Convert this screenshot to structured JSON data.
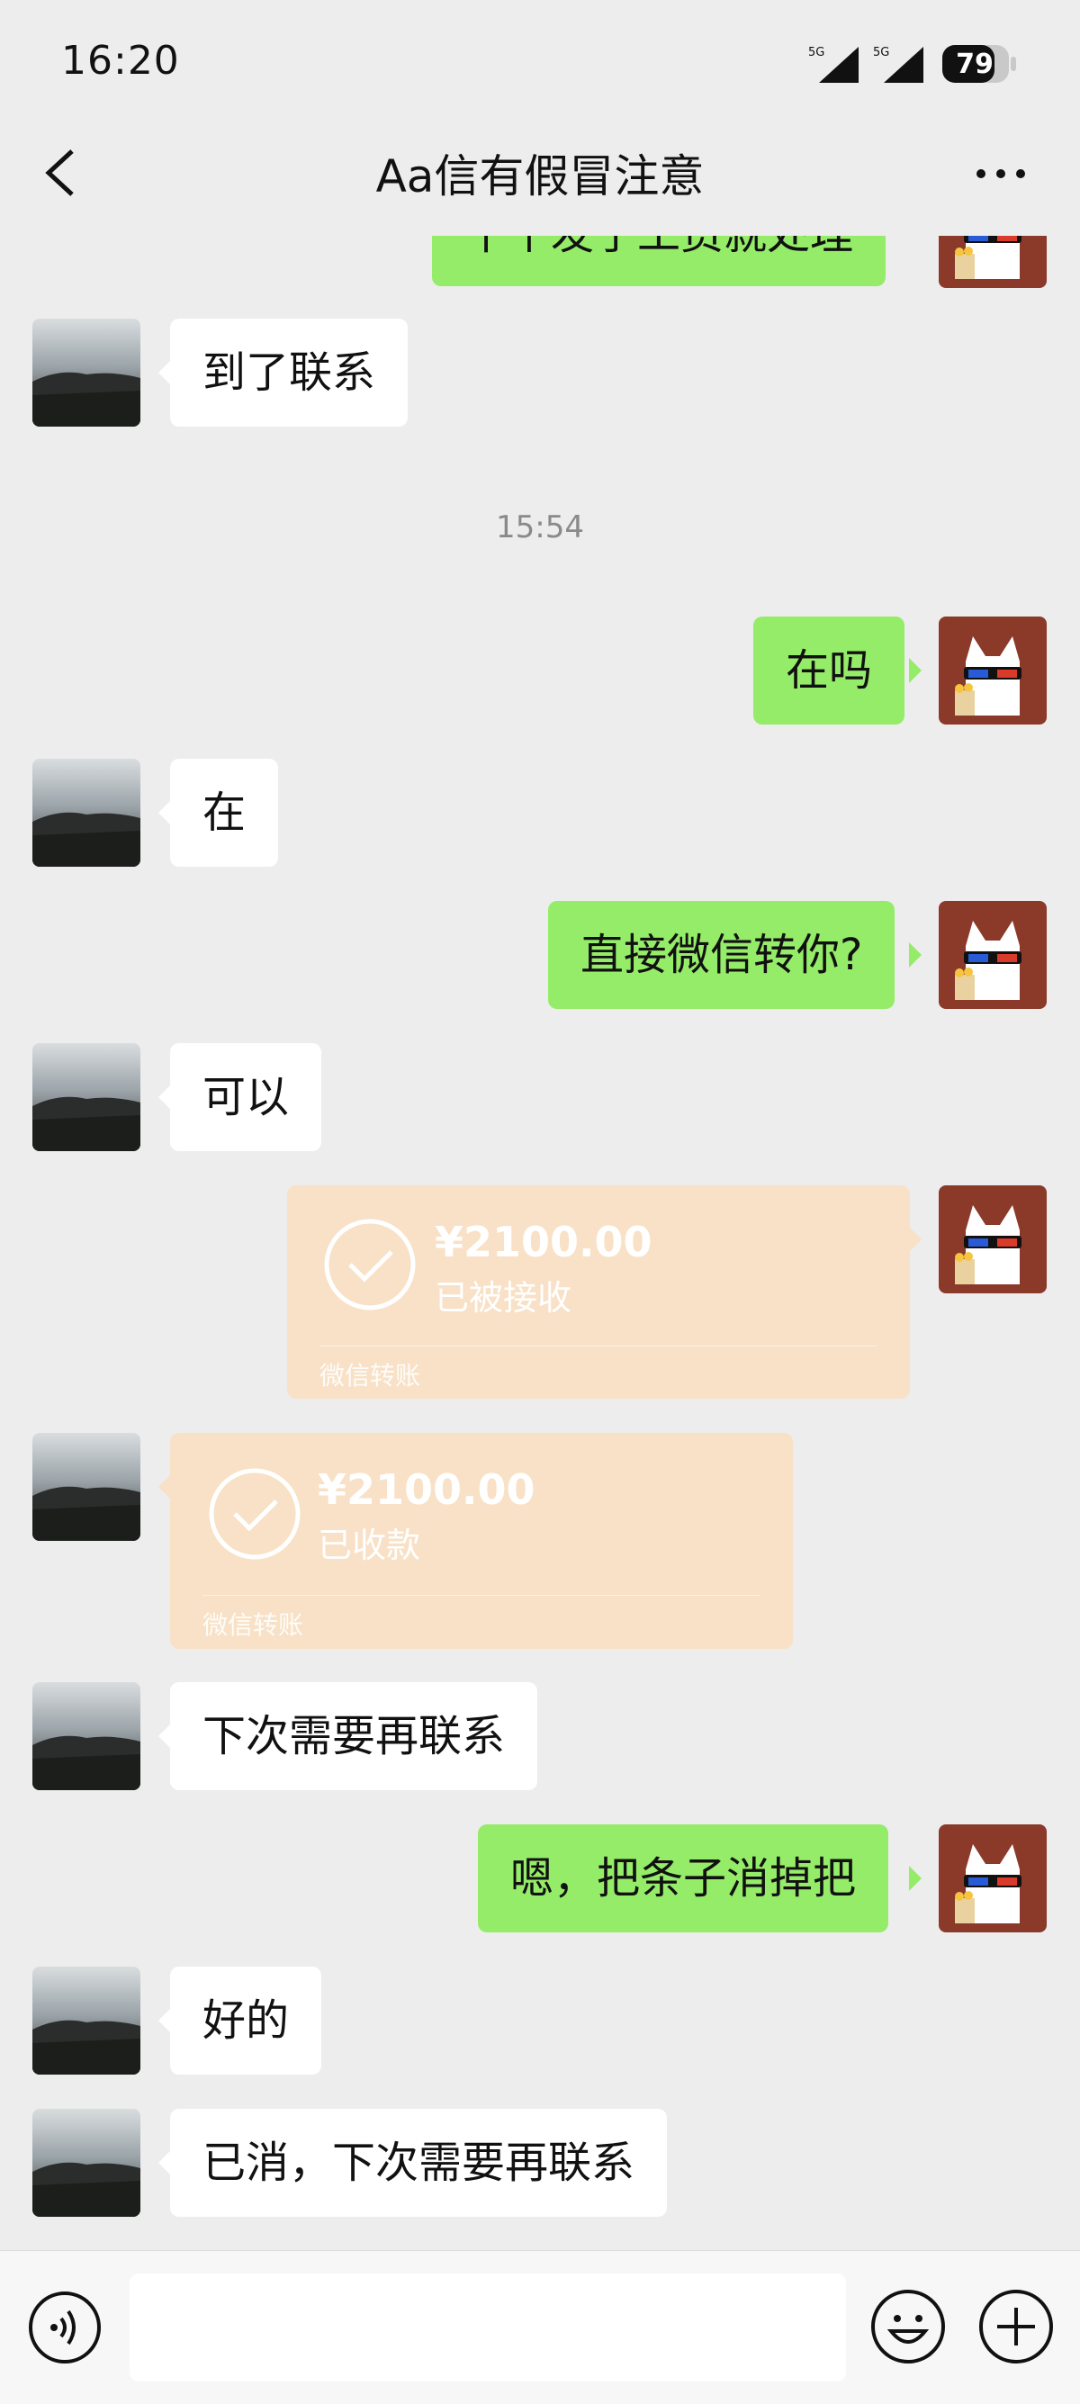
{
  "status_bar": {
    "time": "16:20",
    "network_1": "5G",
    "network_2": "5G",
    "battery": "79"
  },
  "nav": {
    "title": "Aa信有假冒注意",
    "back_icon": "chevron-left-icon",
    "more_icon": "more-dots-icon"
  },
  "chat": {
    "partial_top_text": "十个发了工资就处理",
    "timestamp": "15:54",
    "messages": [
      {
        "side": "in",
        "text": "到了联系"
      },
      {
        "side": "out",
        "text": "在吗"
      },
      {
        "side": "in",
        "text": "在"
      },
      {
        "side": "out",
        "text": "直接微信转你?"
      },
      {
        "side": "in",
        "text": "可以"
      },
      {
        "side": "in",
        "text": "下次需要再联系"
      },
      {
        "side": "out",
        "text": "嗯，把条子消掉把"
      },
      {
        "side": "in",
        "text": "好的"
      },
      {
        "side": "in",
        "text": "已消，下次需要再联系"
      }
    ],
    "transfers": [
      {
        "side": "out",
        "amount": "¥2100.00",
        "status": "已被接收",
        "footer": "微信转账"
      },
      {
        "side": "in",
        "amount": "¥2100.00",
        "status": "已收款",
        "footer": "微信转账"
      }
    ]
  },
  "input_bar": {
    "voice_icon": "voice-icon",
    "emoji_icon": "emoji-icon",
    "plus_icon": "plus-icon",
    "value": ""
  },
  "colors": {
    "background": "#ededed",
    "outgoing_bubble": "#95ec69",
    "incoming_bubble": "#ffffff",
    "transfer_card": "#f8e1c6"
  }
}
